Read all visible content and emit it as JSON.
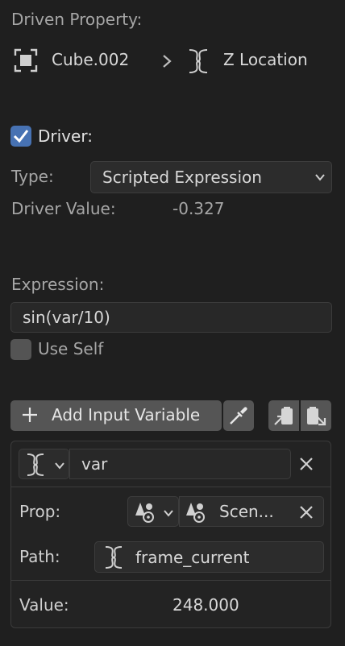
{
  "header": {
    "section_label": "Driven Property:",
    "object_name": "Cube.002",
    "property_name": "Z Location",
    "separator": ">"
  },
  "driver": {
    "checkbox_label": "Driver:",
    "checked": true,
    "type_label": "Type:",
    "type_value": "Scripted Expression",
    "value_label": "Driver Value:",
    "value": "-0.327"
  },
  "expression": {
    "label": "Expression:",
    "value": "sin(var/10)",
    "use_self_label": "Use Self",
    "use_self_checked": false
  },
  "toolbar": {
    "add_variable_label": "Add Input Variable",
    "add_icon": "+"
  },
  "variable": {
    "name": "var",
    "prop_label": "Prop:",
    "prop_value": "Scen...",
    "path_label": "Path:",
    "path_value": "frame_current",
    "value_label": "Value:",
    "value": "248.000"
  },
  "colors": {
    "accent": "#4772b3",
    "background": "#1f1f1f",
    "panel": "#232323",
    "button": "#555555"
  },
  "icons": [
    "object-icon",
    "chevron-right-icon",
    "driver-fcurve-icon",
    "checkmark-icon",
    "dropdown-arrow-icon",
    "plus-icon",
    "eyedropper-icon",
    "copy-icon",
    "paste-icon",
    "close-icon",
    "scene-data-icon"
  ]
}
